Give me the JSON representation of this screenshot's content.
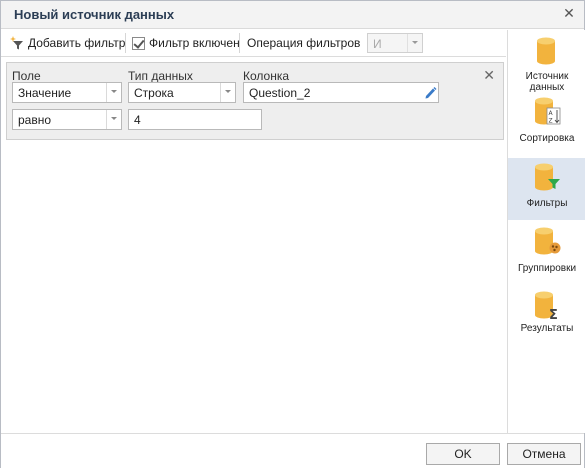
{
  "dialog": {
    "title": "Новый источник данных"
  },
  "toolbar": {
    "add_filter": "Добавить фильтр",
    "filter_enabled": "Фильтр включен",
    "filter_enabled_checked": true,
    "operation_label": "Операция фильтров",
    "operation_value": "И"
  },
  "filter": {
    "field_label": "Поле",
    "type_label": "Тип данных",
    "column_label": "Колонка",
    "field_value": "Значение",
    "type_value": "Строка",
    "column_value": "Question_2",
    "condition_value": "равно",
    "operand_value": "4"
  },
  "sidebar": {
    "items": [
      {
        "label": "Источник данных",
        "icon": "database-icon",
        "active": false
      },
      {
        "label": "Сортировка",
        "icon": "sort-az-icon",
        "active": false
      },
      {
        "label": "Фильтры",
        "icon": "filter-icon",
        "active": true
      },
      {
        "label": "Группировки",
        "icon": "grouping-icon",
        "active": false
      },
      {
        "label": "Результаты",
        "icon": "sum-icon",
        "active": false
      }
    ]
  },
  "footer": {
    "ok": "OK",
    "cancel": "Отмена"
  },
  "colors": {
    "db_gold": "#f2b33d",
    "db_light": "#f7cf6e",
    "filter_green": "#2ea84a",
    "active_nav": "#dde5f0",
    "title": "#2c3e55"
  }
}
